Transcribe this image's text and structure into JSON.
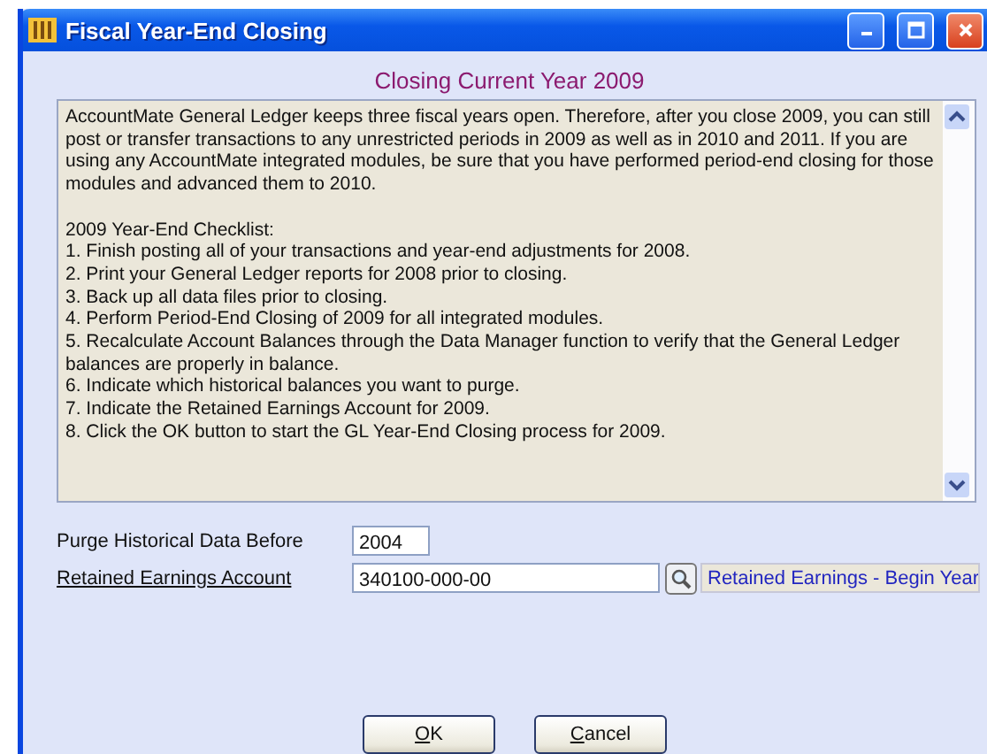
{
  "window": {
    "title": "Fiscal Year-End Closing"
  },
  "heading": "Closing Current Year 2009",
  "notes": {
    "intro": "AccountMate General Ledger keeps three fiscal years open. Therefore, after you close 2009, you can still post or transfer transactions to any unrestricted periods in 2009 as well as in 2010 and 2011. If you are using any AccountMate integrated modules, be sure that you have performed period-end closing for those modules and advanced them to 2010.",
    "checklist_title": "2009 Year-End Checklist:",
    "checklist": [
      "1. Finish posting all of your transactions and year-end adjustments for 2008.",
      "2. Print your General Ledger reports for 2008 prior to closing.",
      "3. Back up all data files prior to closing.",
      "4. Perform Period-End Closing of 2009 for all integrated modules.",
      "5. Recalculate Account Balances through the Data Manager function to verify that the General Ledger balances are properly in balance.",
      "6. Indicate which historical balances you want to purge.",
      "7. Indicate the Retained Earnings Account for 2009.",
      "8. Click the OK button to start the GL Year-End Closing process for 2009."
    ]
  },
  "purge": {
    "label": "Purge Historical Data Before",
    "value": "2004"
  },
  "retained": {
    "label": "Retained Earnings Account",
    "value": "340100-000-00",
    "description": "Retained Earnings - Begin Year"
  },
  "buttons": [
    "OK",
    "Cancel"
  ]
}
